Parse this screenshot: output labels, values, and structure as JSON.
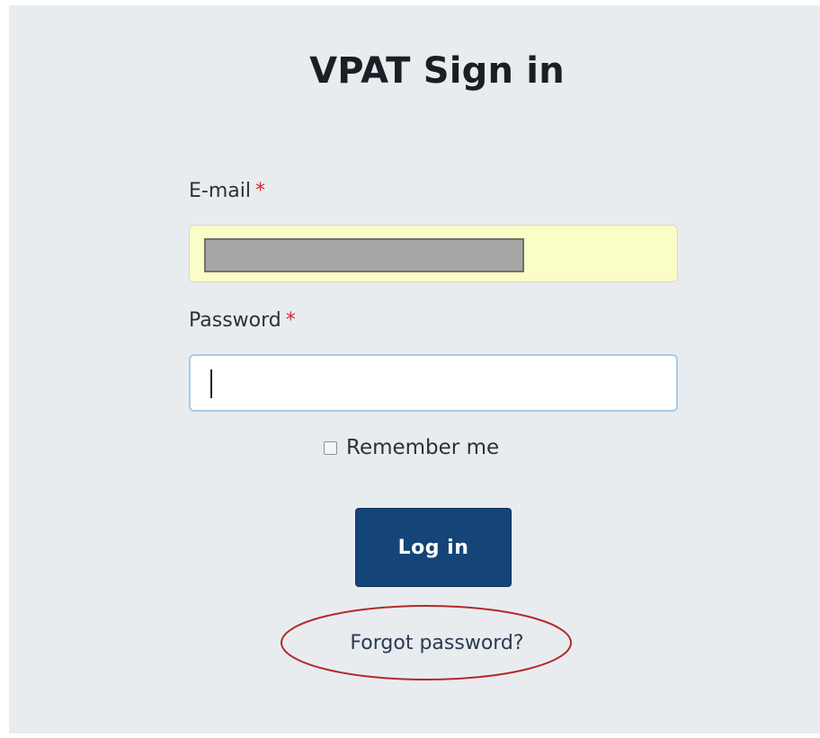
{
  "page": {
    "title": "VPAT Sign in"
  },
  "form": {
    "email_label": "E-mail",
    "password_label": "Password",
    "required_marker": "*",
    "remember_label": "Remember me",
    "remember_checked": false,
    "login_button": "Log in",
    "forgot_link": "Forgot password?"
  },
  "colors": {
    "primary_button": "#154478",
    "required_marker": "#e0242a",
    "autofill_background": "#fbfdc6",
    "focus_border": "#a7cbe7",
    "annotation_circle": "#b22a2a"
  }
}
